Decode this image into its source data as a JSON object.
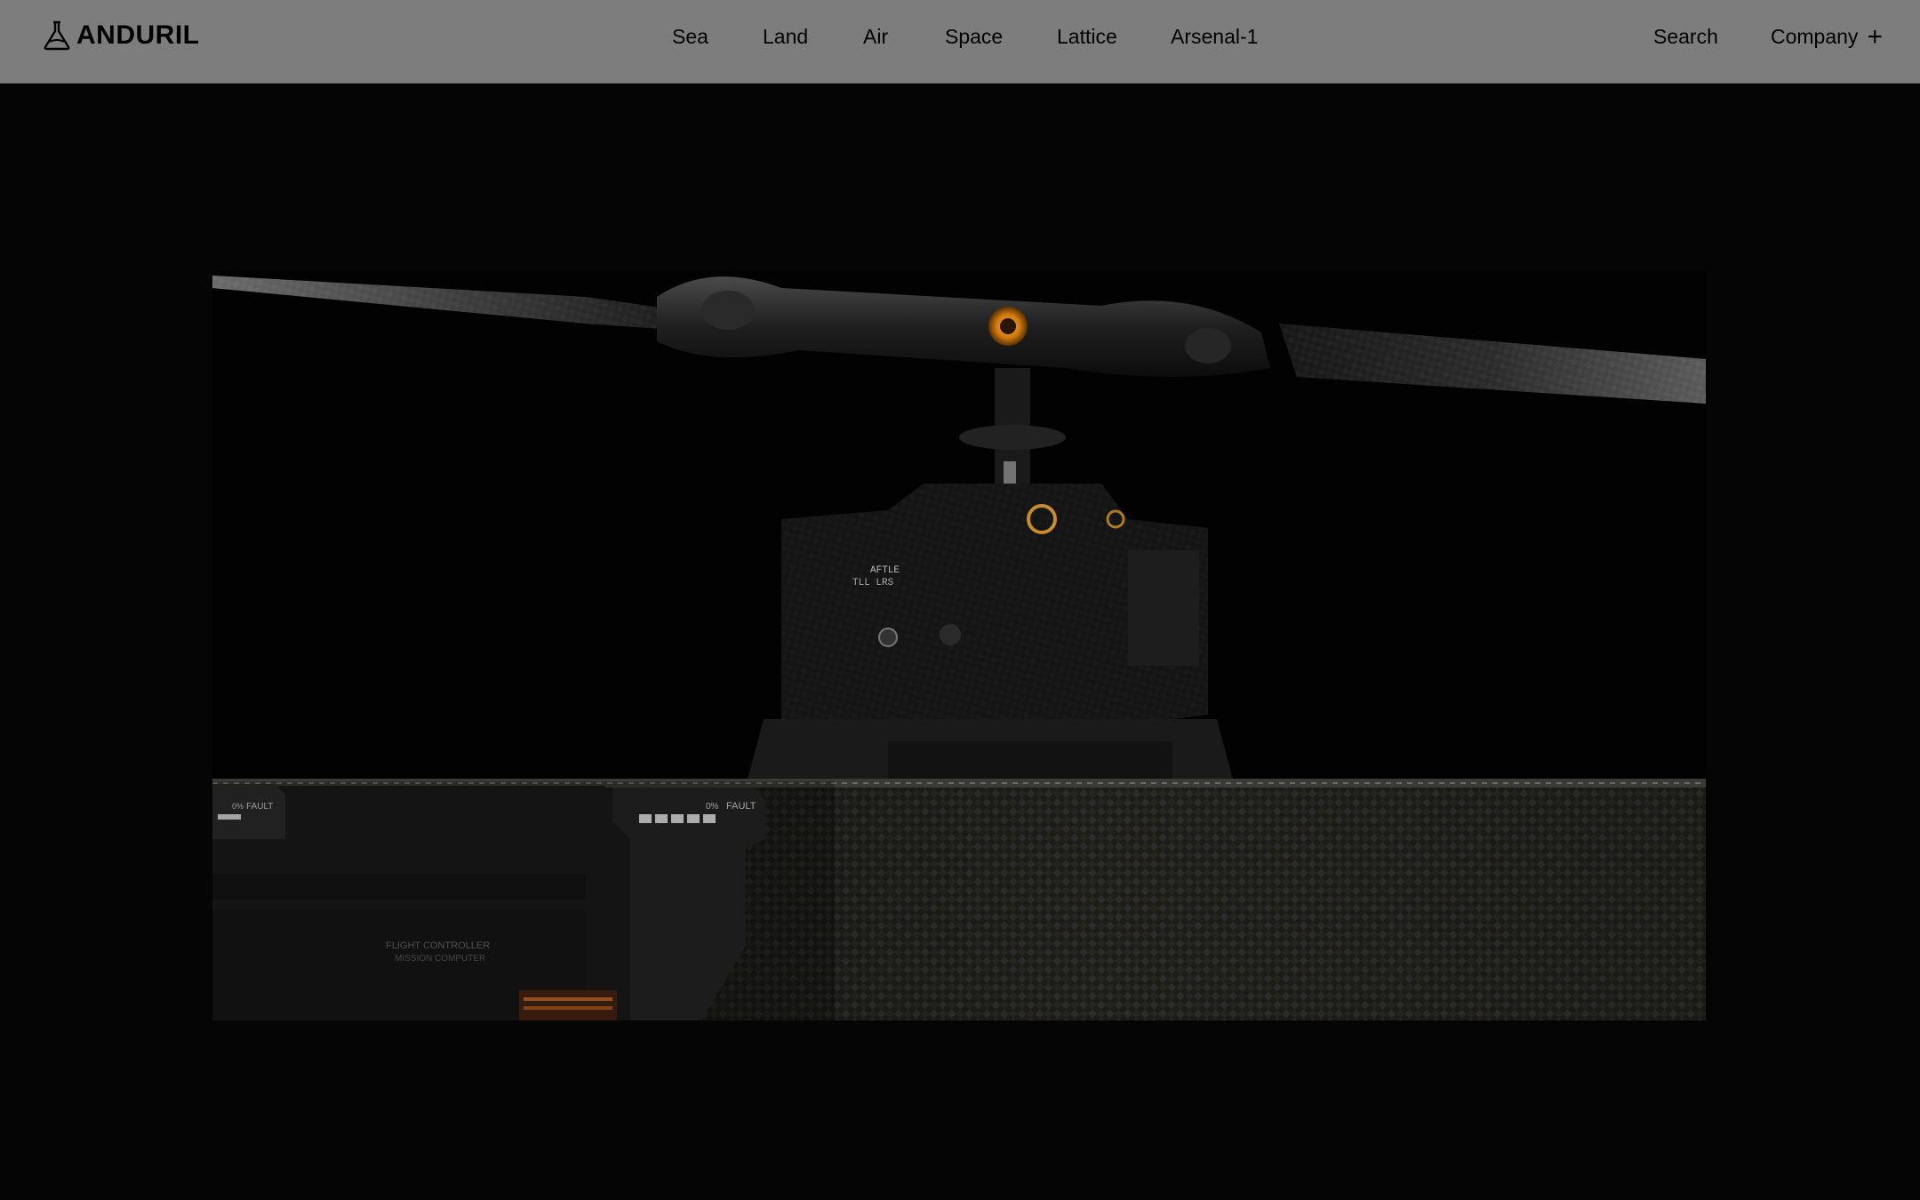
{
  "brand": {
    "name": "ANDURIL",
    "logo_icon": "anduril-flask-icon"
  },
  "nav": {
    "links": [
      {
        "label": "Sea"
      },
      {
        "label": "Land"
      },
      {
        "label": "Air"
      },
      {
        "label": "Space"
      },
      {
        "label": "Lattice"
      },
      {
        "label": "Arsenal-1"
      }
    ],
    "search_label": "Search",
    "company_label": "Company",
    "company_icon": "plus-icon"
  },
  "hero": {
    "image_description_icon": "helicopter-rotor-photo",
    "panel_labels": {
      "fault_left": "FAULT",
      "fault_right": "FAULT",
      "percent_left": "0%",
      "percent_right": "0%",
      "flight_controller": "FLIGHT CONTROLLER",
      "mission_computer": "MISSION COMPUTER"
    }
  },
  "colors": {
    "nav_background": "#7d7d7d",
    "page_background": "#050505",
    "accent_orange": "#e0901c"
  }
}
